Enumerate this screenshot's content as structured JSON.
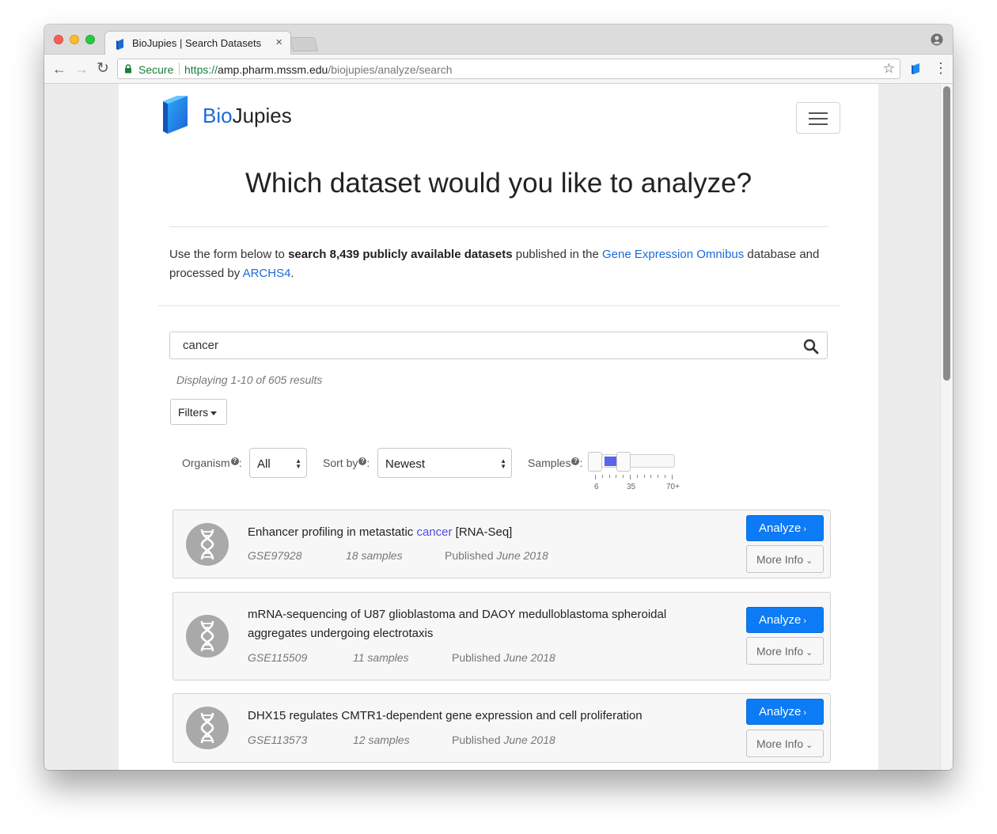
{
  "browser": {
    "tab_title": "BioJupies | Search Datasets",
    "tab_close": "×",
    "secure_label": "Secure",
    "url_scheme": "https://",
    "url_host": "amp.pharm.mssm.edu",
    "url_path": "/biojupies/analyze/search",
    "back_glyph": "←",
    "forward_glyph": "→",
    "reload_glyph": "↻",
    "star_glyph": "☆",
    "menu_glyph": "⋮"
  },
  "brand": {
    "name_part1": "Bio",
    "name_part2": "Jupies"
  },
  "headline": "Which dataset would you like to analyze?",
  "intro": {
    "text1": "Use the form below to ",
    "bold": "search 8,439 publicly available datasets",
    "text2": " published in the ",
    "link1": "Gene Expression Omnibus",
    "text3": " database and processed by ",
    "link2": "ARCHS4",
    "text4": "."
  },
  "search": {
    "value": "cancer"
  },
  "results_count": "Displaying 1-10 of 605 results",
  "filters_label": "Filters",
  "filters": {
    "organism_label": "Organism",
    "organism_value": "All",
    "sort_label": "Sort by",
    "sort_value": "Newest",
    "samples_label": "Samples",
    "help_glyph": "?",
    "colon": ":",
    "samples_min": "6",
    "samples_mid": "35",
    "samples_max": "70+",
    "samples_range_selected": [
      6,
      35
    ]
  },
  "datasets": [
    {
      "title_pre": "Enhancer profiling in metastatic ",
      "title_hl": "cancer",
      "title_post": " [RNA-Seq]",
      "accession": "GSE97928",
      "samples": "18 samples",
      "published_label": "Published ",
      "published_date": "June 2018"
    },
    {
      "title_pre": "mRNA-sequencing of U87 glioblastoma and DAOY medulloblastoma spheroidal aggregates undergoing electrotaxis",
      "title_hl": "",
      "title_post": "",
      "accession": "GSE115509",
      "samples": "11 samples",
      "published_label": "Published ",
      "published_date": "June 2018"
    },
    {
      "title_pre": "DHX15 regulates CMTR1-dependent gene expression and cell proliferation",
      "title_hl": "",
      "title_post": "",
      "accession": "GSE113573",
      "samples": "12 samples",
      "published_label": "Published ",
      "published_date": "June 2018"
    }
  ],
  "buttons": {
    "analyze": "Analyze",
    "more_info": "More Info",
    "analyze_chevron": "›",
    "more_chevron": "⌄"
  },
  "colors": {
    "brand_blue": "#1c6ad8",
    "primary_button": "#0c7bf5",
    "slider_fill": "#5b63ee",
    "highlight": "#4b4fe8"
  }
}
